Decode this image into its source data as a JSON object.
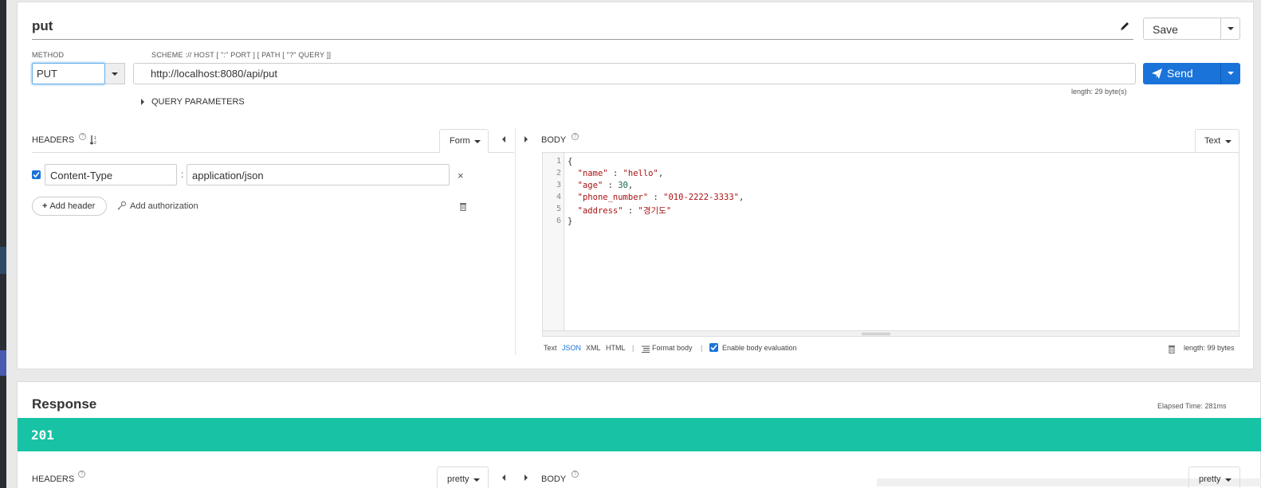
{
  "request": {
    "name": "put",
    "save_label": "Save",
    "method_label": "METHOD",
    "method_value": "PUT",
    "scheme_label": "SCHEME :// HOST [ \":\" PORT ] [ PATH [ \"?\" QUERY ]]",
    "url": "http://localhost:8080/api/put",
    "url_length": "length: 29 byte(s)",
    "send_label": "Send",
    "query_params_label": "QUERY PARAMETERS"
  },
  "headers": {
    "label": "HEADERS",
    "form_label": "Form",
    "rows": [
      {
        "enabled": true,
        "key": "Content-Type",
        "value": "application/json"
      }
    ],
    "add_header_label": "Add header",
    "add_authorization_label": "Add authorization"
  },
  "body": {
    "label": "BODY",
    "mode_label": "Text",
    "line_numbers": [
      "1",
      "2",
      "3",
      "4",
      "5",
      "6"
    ],
    "code": {
      "l1": "{",
      "l2_key": "\"name\"",
      "l2_sep": " : ",
      "l2_val": "\"hello\"",
      "l2_end": ",",
      "l3_key": "\"age\"",
      "l3_sep": " : ",
      "l3_val": "30",
      "l3_end": ",",
      "l4_key": "\"phone_number\"",
      "l4_sep": " : ",
      "l4_val": "\"010-2222-3333\"",
      "l4_end": ",",
      "l5_key": "\"address\"",
      "l5_sep": " : ",
      "l5_val": "\"경기도\"",
      "l6": "}"
    },
    "formats": {
      "text": "Text",
      "json": "JSON",
      "xml": "XML",
      "html": "HTML"
    },
    "format_body_label": "Format body",
    "enable_eval_label": "Enable body evaluation",
    "length": "length: 99 bytes",
    "separator": "|"
  },
  "response": {
    "title": "Response",
    "elapsed": "Elapsed Time: 281ms",
    "status": "201",
    "status_color": "#18c2a4",
    "headers_label": "HEADERS",
    "headers_mode": "pretty",
    "body_label": "BODY",
    "body_mode": "pretty"
  },
  "colors": {
    "accent": "#1a73d9",
    "json_key": "#aa1111",
    "json_number": "#116644"
  }
}
